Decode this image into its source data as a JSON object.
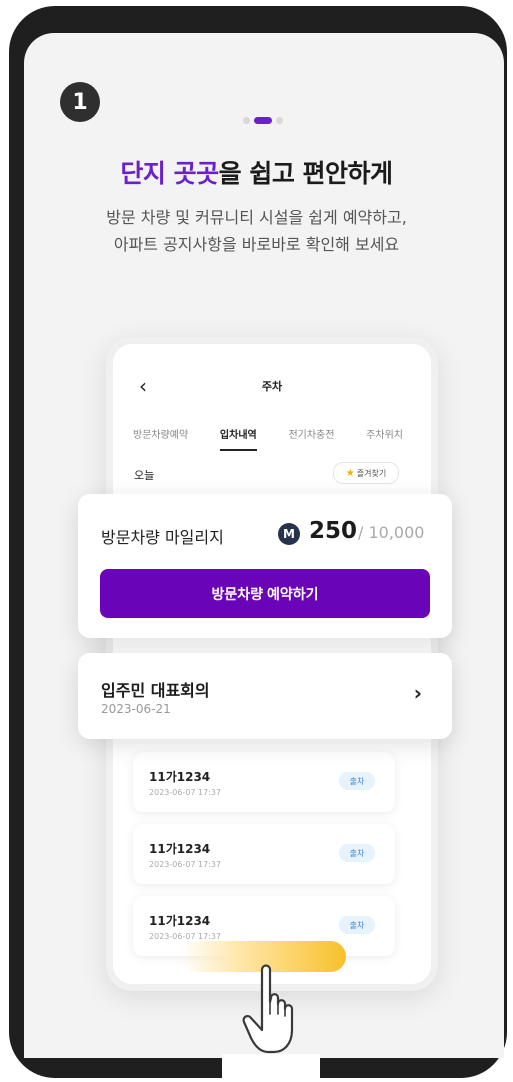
{
  "step_number": "1",
  "pager": {
    "count": 3,
    "active_index": 1
  },
  "headline": {
    "accent": "단지 곳곳",
    "rest": "을 쉽고 편안하게"
  },
  "subtext": {
    "line1": "방문 차량 및 커뮤니티 시설을 쉽게 예약하고,",
    "line2": "아파트 공지사항을 바로바로 확인해 보세요"
  },
  "inner_app": {
    "back_glyph": "‹",
    "title": "주차",
    "tabs": [
      "방문차량예약",
      "입차내역",
      "전기차충전",
      "주차위치"
    ],
    "active_tab": "입차내역",
    "today_label": "오늘",
    "favorite_label": "즐겨찾기",
    "history": [
      {
        "plate": "11가1234",
        "time": "2023-06-07 17:37",
        "badge": "출차"
      },
      {
        "plate": "11가1234",
        "time": "2023-06-07 17:37",
        "badge": "출차"
      },
      {
        "plate": "11가1234",
        "time": "2023-06-07 17:37",
        "badge": "출차"
      }
    ]
  },
  "mileage_card": {
    "label": "방문차량 마일리지",
    "icon_letter": "M",
    "value": "250",
    "total": "/ 10,000",
    "button_label": "방문차량 예약하기"
  },
  "meeting_card": {
    "title": "입주민 대표회의",
    "date": "2023-06-21",
    "chevron": "›"
  },
  "colors": {
    "accent": "#6a1fd0",
    "button": "#6a04b8",
    "badge_bg": "#e6f2fc",
    "badge_text": "#3a8ad8",
    "swipe": "#f7c12a"
  },
  "icons": [
    "back-chevron-icon",
    "star-icon",
    "mileage-m-icon",
    "chevron-right-icon",
    "pointing-hand-icon"
  ]
}
